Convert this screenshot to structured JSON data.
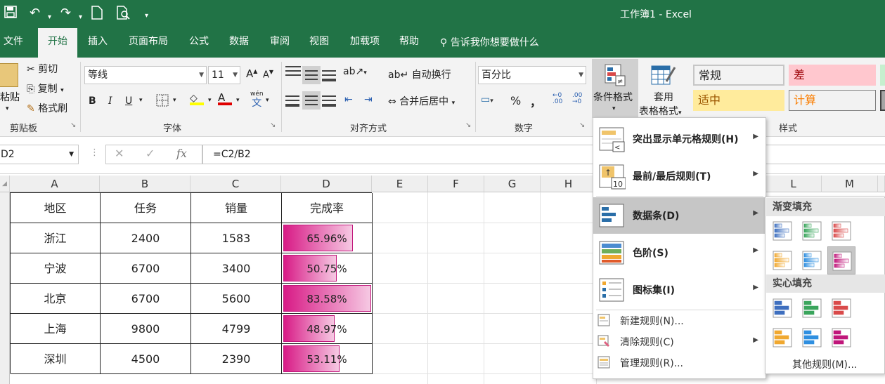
{
  "app": {
    "title": "工作簿1 - Excel"
  },
  "tabs": [
    "文件",
    "开始",
    "插入",
    "页面布局",
    "公式",
    "数据",
    "审阅",
    "视图",
    "加载项",
    "帮助"
  ],
  "active_tab": "开始",
  "tell_me": "告诉我你想要做什么",
  "clipboard": {
    "paste": "粘贴",
    "cut": "剪切",
    "copy": "复制",
    "format_painter": "格式刷",
    "group": "剪贴板"
  },
  "font": {
    "name": "等线",
    "size": "11",
    "group": "字体",
    "bold": "B",
    "italic": "I",
    "underline": "U",
    "grow": "A",
    "shrink": "A",
    "phonetic": "文",
    "phonetic_top": "wén"
  },
  "alignment": {
    "wrap": "自动换行",
    "merge": "合并后居中",
    "group": "对齐方式"
  },
  "number": {
    "format": "百分比",
    "group": "数字",
    "percent": "%",
    "comma": "，"
  },
  "styles": {
    "conditional_format": "条件格式",
    "format_table_1": "套用",
    "format_table_2": "表格格式",
    "cells": [
      {
        "label": "常规",
        "bg": "#ffffff",
        "color": "#000000",
        "border": "#c6c6c6"
      },
      {
        "label": "差",
        "bg": "#ffc7ce",
        "color": "#9c0006",
        "border": "#ffc7ce"
      },
      {
        "label": "适中",
        "bg": "#ffeb9c",
        "color": "#9c5700",
        "border": "#ffeb9c"
      },
      {
        "label": "计算",
        "bg": "#f2f2f2",
        "color": "#fa7d00",
        "border": "#7f7f7f"
      }
    ],
    "group": "样式"
  },
  "formula_bar": {
    "name_box": "D2",
    "fx": "fx",
    "formula": "=C2/B2"
  },
  "columns": [
    "A",
    "B",
    "C",
    "D",
    "E",
    "F",
    "G",
    "H",
    "L",
    "M"
  ],
  "table": {
    "headers": [
      "地区",
      "任务",
      "销量",
      "完成率"
    ],
    "rows": [
      {
        "region": "浙江",
        "task": "2400",
        "sales": "1583",
        "rate": "65.96%",
        "rate_value": 0.6596
      },
      {
        "region": "宁波",
        "task": "6700",
        "sales": "3400",
        "rate": "50.75%",
        "rate_value": 0.5075
      },
      {
        "region": "北京",
        "task": "6700",
        "sales": "5600",
        "rate": "83.58%",
        "rate_value": 0.8358
      },
      {
        "region": "上海",
        "task": "9800",
        "sales": "4799",
        "rate": "48.97%",
        "rate_value": 0.4897
      },
      {
        "region": "深圳",
        "task": "4500",
        "sales": "2390",
        "rate": "53.11%",
        "rate_value": 0.5311
      }
    ]
  },
  "cf_menu": {
    "items": [
      {
        "label": "突出显示单元格规则(H)",
        "icon": "highlight-cells-icon"
      },
      {
        "label": "最前/最后规则(T)",
        "icon": "top-bottom-icon",
        "badge": "10"
      },
      {
        "label": "数据条(D)",
        "icon": "data-bars-icon"
      },
      {
        "label": "色阶(S)",
        "icon": "color-scales-icon"
      },
      {
        "label": "图标集(I)",
        "icon": "icon-sets-icon"
      }
    ],
    "small_items": [
      {
        "label": "新建规则(N)...",
        "icon": "new-rule-icon"
      },
      {
        "label": "清除规则(C)",
        "icon": "clear-rules-icon"
      },
      {
        "label": "管理规则(R)...",
        "icon": "manage-rules-icon"
      }
    ]
  },
  "data_bar_submenu": {
    "gradient_header": "渐变填充",
    "solid_header": "实心填充",
    "colors": [
      "#3e6fbf",
      "#3aa55c",
      "#d94a4a",
      "#f0a830",
      "#2f8fe0",
      "#c0167a"
    ],
    "more": "其他规则(M)..."
  }
}
